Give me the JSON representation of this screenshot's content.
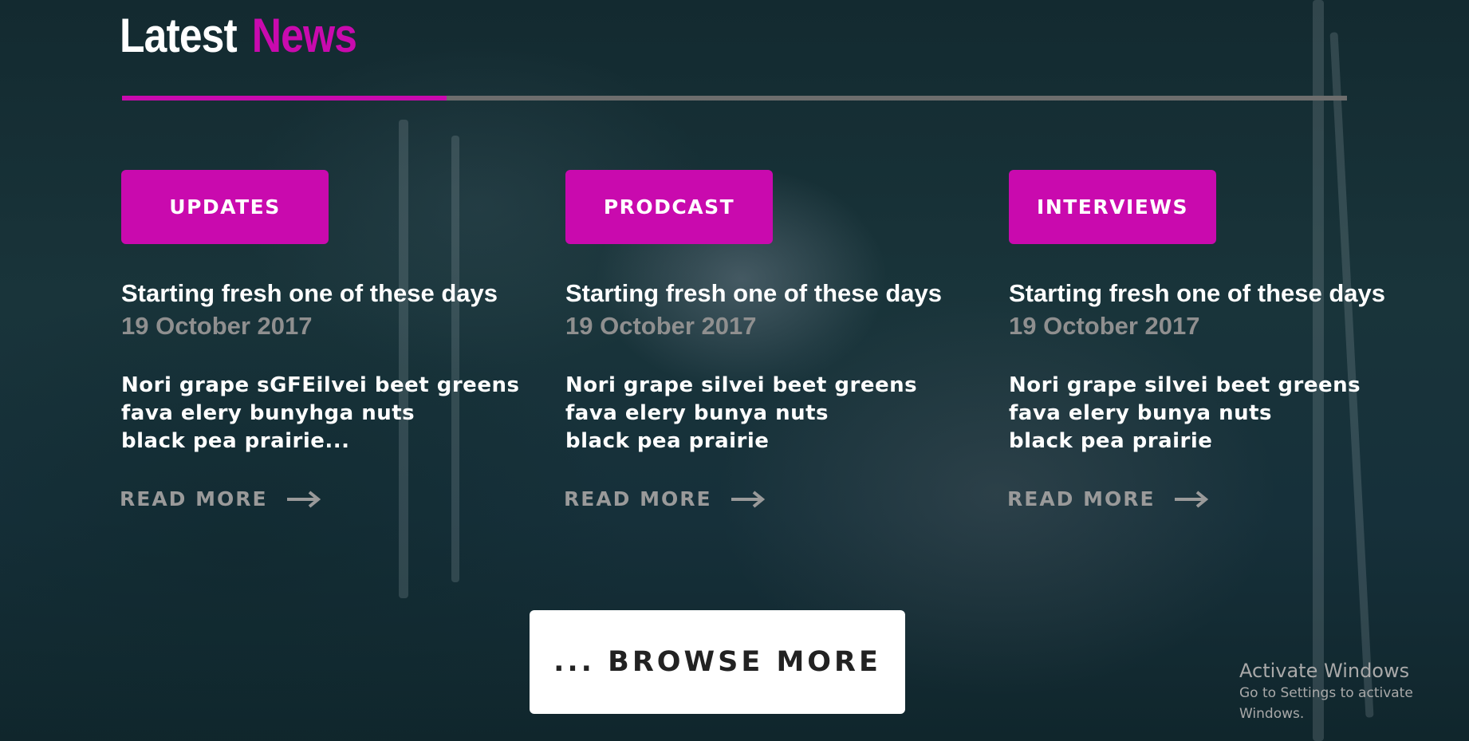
{
  "section": {
    "heading_word1": "Latest",
    "heading_word2": "News",
    "divider_progress": 0.265
  },
  "cards": [
    {
      "tag": "UPDATES",
      "title": "Starting fresh one of these days",
      "date": "19 October 2017",
      "excerpt": "Nori grape sGFEilvei beet greens\nfava  elery bunyhga nuts\nblack pea prairie...",
      "read_more": "READ MORE"
    },
    {
      "tag": "PRODCAST",
      "title": "Starting fresh one of these days",
      "date": "19 October 2017",
      "excerpt": "Nori grape silvei beet greens\nfava  elery bunya nuts\nblack pea prairie",
      "read_more": "READ MORE"
    },
    {
      "tag": "INTERVIEWS",
      "title": "Starting fresh one of these days",
      "date": "19 October 2017",
      "excerpt": "Nori grape silvei beet greens\nfava  elery bunya nuts\nblack pea prairie",
      "read_more": "READ MORE"
    }
  ],
  "browse_label": "... BROWSE MORE",
  "watermark": {
    "title": "Activate Windows",
    "subtitle": "Go to Settings to activate Windows."
  },
  "colors": {
    "accent": "#c90aae",
    "divider_track": "#6d6d6d",
    "muted_text": "#8f8f8f"
  },
  "icons": {
    "read_more": "arrow-right-icon"
  }
}
